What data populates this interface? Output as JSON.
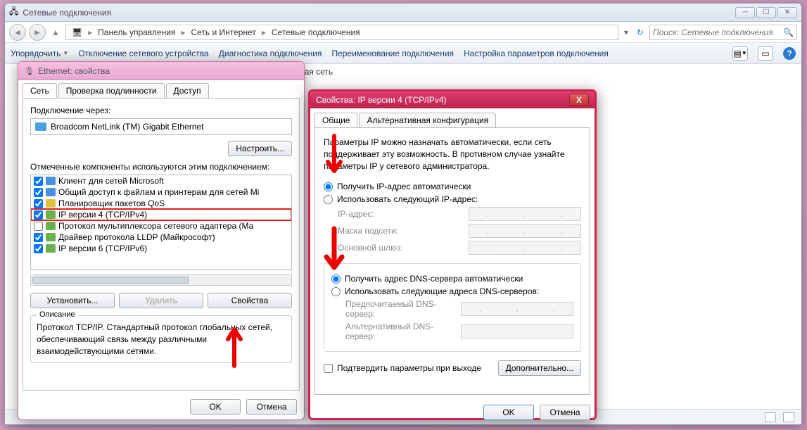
{
  "main": {
    "title": "Сетевые подключения",
    "breadcrumb": [
      "Панель управления",
      "Сеть и Интернет",
      "Сетевые подключения"
    ],
    "search_placeholder": "Поиск: Сетевые подключения",
    "toolbar": {
      "organize": "Упорядочить",
      "disable": "Отключение сетевого устройства",
      "diagnose": "Диагностика подключения",
      "rename": "Переименование подключения",
      "settings": "Настройка параметров подключения"
    },
    "partial_network": "дная сеть"
  },
  "eth": {
    "title": "Ethernet: свойства",
    "tabs": {
      "net": "Сеть",
      "auth": "Проверка подлинности",
      "access": "Доступ"
    },
    "connect_via": "Подключение через:",
    "adapter": "Broadcom NetLink (TM) Gigabit Ethernet",
    "configure": "Настроить...",
    "components_label": "Отмеченные компоненты используются этим подключением:",
    "components": [
      "Клиент для сетей Microsoft",
      "Общий доступ к файлам и принтерам для сетей Mi",
      "Планировщик пакетов QoS",
      "IP версии 4 (TCP/IPv4)",
      "Протокол мультиплексора сетевого адаптера (Ма",
      "Драйвер протокола LLDP (Майкрософт)",
      "IP версии 6 (TCP/IPv6)"
    ],
    "install": "Установить...",
    "uninstall": "Удалить",
    "properties": "Свойства",
    "desc_title": "Описание",
    "desc_text": "Протокол TCP/IP. Стандартный протокол глобальных сетей, обеспечивающий связь между различными взаимодействующими сетями.",
    "ok": "OK",
    "cancel": "Отмена"
  },
  "ipv4": {
    "title": "Свойства: IP версии 4 (TCP/IPv4)",
    "tabs": {
      "general": "Общие",
      "alt": "Альтернативная конфигурация"
    },
    "info": "Параметры IP можно назначать автоматически, если сеть поддерживает эту возможность. В противном случае узнайте параметры IP у сетевого администратора.",
    "ip_auto": "Получить IP-адрес автоматически",
    "ip_manual": "Использовать следующий IP-адрес:",
    "ip_addr": "IP-адрес:",
    "mask": "Маска подсети:",
    "gateway": "Основной шлюз:",
    "dns_auto": "Получить адрес DNS-сервера автоматически",
    "dns_manual": "Использовать следующие адреса DNS-серверов:",
    "dns_pref": "Предпочитаемый DNS-сервер:",
    "dns_alt": "Альтернативный DNS-сервер:",
    "validate": "Подтвердить параметры при выходе",
    "advanced": "Дополнительно...",
    "ok": "OK",
    "cancel": "Отмена"
  }
}
